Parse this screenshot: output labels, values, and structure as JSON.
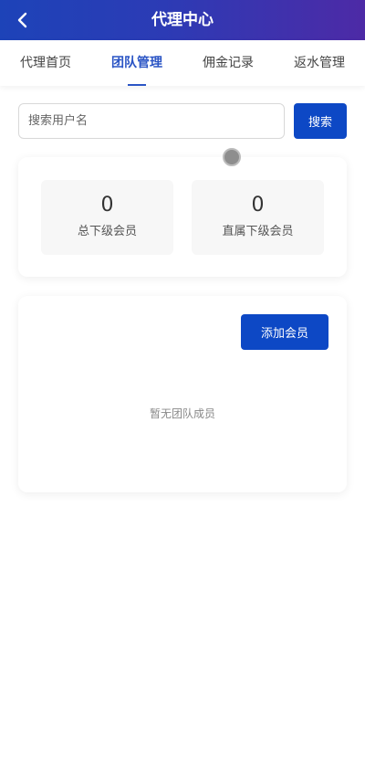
{
  "header": {
    "title": "代理中心",
    "back_icon": "chevron-left-icon"
  },
  "tabs": [
    {
      "label": "代理首页",
      "active": false
    },
    {
      "label": "团队管理",
      "active": true
    },
    {
      "label": "佣金记录",
      "active": false
    },
    {
      "label": "返水管理",
      "active": false
    }
  ],
  "search": {
    "placeholder": "搜索用户名",
    "value": "",
    "button_label": "搜索"
  },
  "stats": {
    "total_sub_members": {
      "value": "0",
      "label": "总下级会员"
    },
    "direct_sub_members": {
      "value": "0",
      "label": "直属下级会员"
    }
  },
  "team": {
    "add_button_label": "添加会员",
    "empty_text": "暂无团队成员"
  },
  "colors": {
    "header_gradient_start": "#1d43b8",
    "header_gradient_end": "#4d2aa6",
    "accent": "#2b55c5",
    "button": "#0d48c5"
  }
}
